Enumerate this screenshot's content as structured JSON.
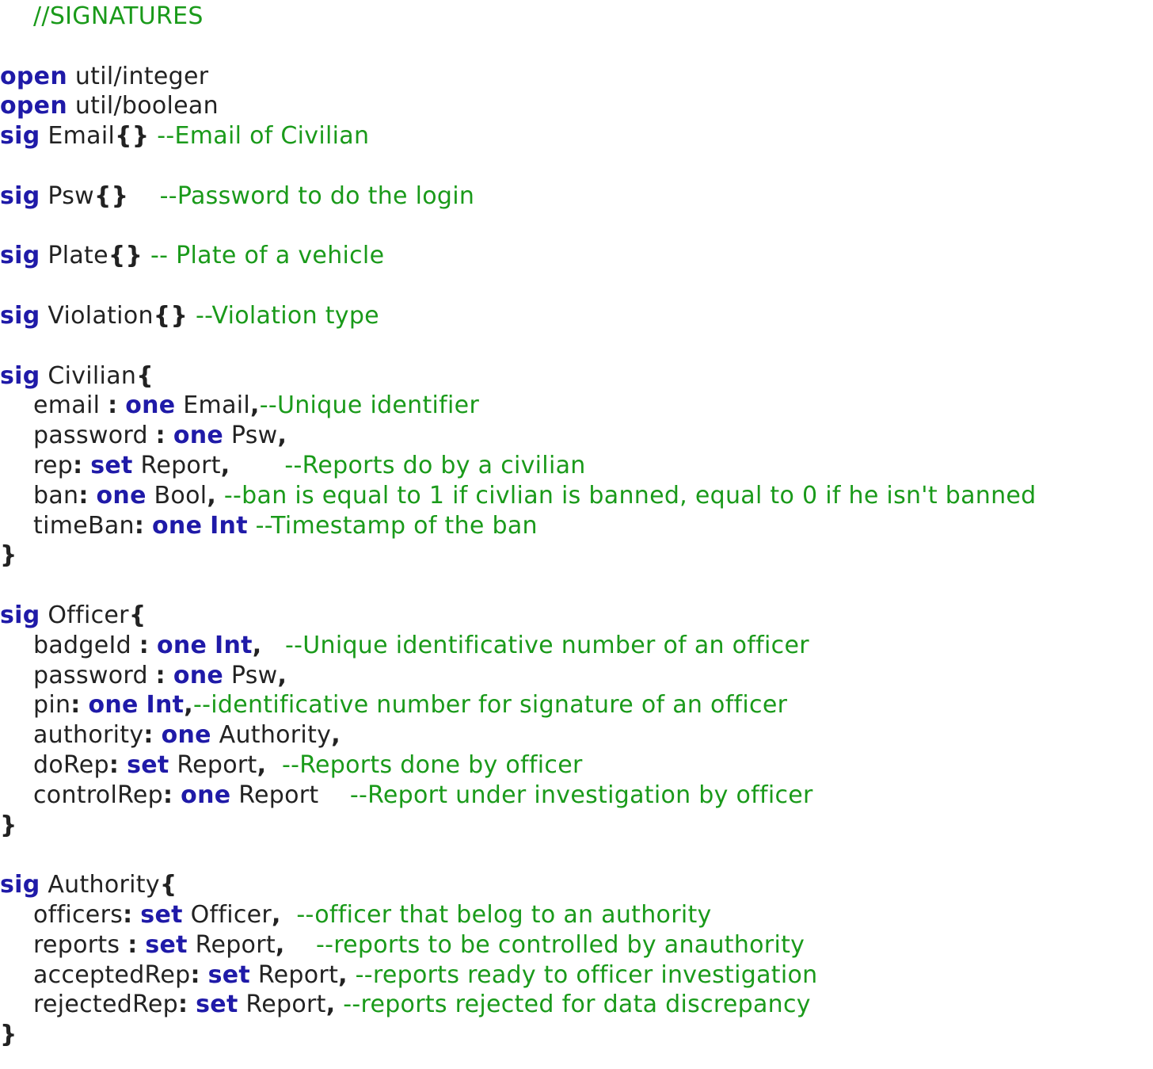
{
  "code": {
    "lines": [
      {
        "indent": true,
        "comment_only": true,
        "tokens": [
          {
            "t": "cm",
            "v": "//SIGNATURES"
          }
        ]
      },
      {
        "indent": false,
        "tokens": []
      },
      {
        "indent": false,
        "tokens": [
          {
            "t": "kw",
            "v": "open"
          },
          {
            "t": "tx",
            "v": " util/integer"
          }
        ]
      },
      {
        "indent": false,
        "tokens": [
          {
            "t": "kw",
            "v": "open"
          },
          {
            "t": "tx",
            "v": " util/boolean"
          }
        ]
      },
      {
        "indent": false,
        "tokens": [
          {
            "t": "kw",
            "v": "sig"
          },
          {
            "t": "tx",
            "v": " Email"
          },
          {
            "t": "br",
            "v": "{}"
          },
          {
            "t": "cm",
            "v": " --Email of Civilian"
          }
        ]
      },
      {
        "indent": false,
        "tokens": []
      },
      {
        "indent": false,
        "tokens": [
          {
            "t": "kw",
            "v": "sig"
          },
          {
            "t": "tx",
            "v": " Psw"
          },
          {
            "t": "br",
            "v": "{}"
          },
          {
            "t": "cm",
            "v": "    --Password to do the login"
          }
        ]
      },
      {
        "indent": false,
        "tokens": []
      },
      {
        "indent": false,
        "tokens": [
          {
            "t": "kw",
            "v": "sig"
          },
          {
            "t": "tx",
            "v": " Plate"
          },
          {
            "t": "br",
            "v": "{}"
          },
          {
            "t": "cm",
            "v": " -- Plate of a vehicle"
          }
        ]
      },
      {
        "indent": false,
        "tokens": []
      },
      {
        "indent": false,
        "tokens": [
          {
            "t": "kw",
            "v": "sig"
          },
          {
            "t": "tx",
            "v": " Violation"
          },
          {
            "t": "br",
            "v": "{}"
          },
          {
            "t": "cm",
            "v": " --Violation type"
          }
        ]
      },
      {
        "indent": false,
        "tokens": []
      },
      {
        "indent": false,
        "tokens": [
          {
            "t": "kw",
            "v": "sig"
          },
          {
            "t": "tx",
            "v": " Civilian"
          },
          {
            "t": "br",
            "v": "{"
          }
        ]
      },
      {
        "indent": true,
        "tokens": [
          {
            "t": "tx",
            "v": "email "
          },
          {
            "t": "br",
            "v": ":"
          },
          {
            "t": "tx",
            "v": " "
          },
          {
            "t": "kw",
            "v": "one"
          },
          {
            "t": "tx",
            "v": " Email"
          },
          {
            "t": "br",
            "v": ","
          },
          {
            "t": "cm",
            "v": "--Unique identifier"
          }
        ]
      },
      {
        "indent": true,
        "tokens": [
          {
            "t": "tx",
            "v": "password "
          },
          {
            "t": "br",
            "v": ":"
          },
          {
            "t": "tx",
            "v": " "
          },
          {
            "t": "kw",
            "v": "one"
          },
          {
            "t": "tx",
            "v": " Psw"
          },
          {
            "t": "br",
            "v": ","
          }
        ]
      },
      {
        "indent": true,
        "tokens": [
          {
            "t": "tx",
            "v": "rep"
          },
          {
            "t": "br",
            "v": ":"
          },
          {
            "t": "tx",
            "v": " "
          },
          {
            "t": "kw",
            "v": "set"
          },
          {
            "t": "tx",
            "v": " Report"
          },
          {
            "t": "br",
            "v": ","
          },
          {
            "t": "cm",
            "v": "       --Reports do by a civilian"
          }
        ]
      },
      {
        "indent": true,
        "tokens": [
          {
            "t": "tx",
            "v": "ban"
          },
          {
            "t": "br",
            "v": ":"
          },
          {
            "t": "tx",
            "v": " "
          },
          {
            "t": "kw",
            "v": "one"
          },
          {
            "t": "tx",
            "v": " Bool"
          },
          {
            "t": "br",
            "v": ","
          },
          {
            "t": "cm",
            "v": " --ban is equal to 1 if civlian is banned, equal to 0 if he isn't banned"
          }
        ]
      },
      {
        "indent": true,
        "tokens": [
          {
            "t": "tx",
            "v": "timeBan"
          },
          {
            "t": "br",
            "v": ":"
          },
          {
            "t": "tx",
            "v": " "
          },
          {
            "t": "kw",
            "v": "one"
          },
          {
            "t": "tx",
            "v": " "
          },
          {
            "t": "kw",
            "v": "Int"
          },
          {
            "t": "cm",
            "v": " --Timestamp of the ban"
          }
        ]
      },
      {
        "indent": false,
        "tokens": [
          {
            "t": "br",
            "v": "}"
          }
        ]
      },
      {
        "indent": false,
        "tokens": []
      },
      {
        "indent": false,
        "tokens": [
          {
            "t": "kw",
            "v": "sig"
          },
          {
            "t": "tx",
            "v": " Officer"
          },
          {
            "t": "br",
            "v": "{"
          }
        ]
      },
      {
        "indent": true,
        "tokens": [
          {
            "t": "tx",
            "v": "badgeId "
          },
          {
            "t": "br",
            "v": ":"
          },
          {
            "t": "tx",
            "v": " "
          },
          {
            "t": "kw",
            "v": "one"
          },
          {
            "t": "tx",
            "v": " "
          },
          {
            "t": "kw",
            "v": "Int"
          },
          {
            "t": "br",
            "v": ","
          },
          {
            "t": "cm",
            "v": "   --Unique identificative number of an officer"
          }
        ]
      },
      {
        "indent": true,
        "tokens": [
          {
            "t": "tx",
            "v": "password "
          },
          {
            "t": "br",
            "v": ":"
          },
          {
            "t": "tx",
            "v": " "
          },
          {
            "t": "kw",
            "v": "one"
          },
          {
            "t": "tx",
            "v": " Psw"
          },
          {
            "t": "br",
            "v": ","
          }
        ]
      },
      {
        "indent": true,
        "tokens": [
          {
            "t": "tx",
            "v": "pin"
          },
          {
            "t": "br",
            "v": ":"
          },
          {
            "t": "tx",
            "v": " "
          },
          {
            "t": "kw",
            "v": "one"
          },
          {
            "t": "tx",
            "v": " "
          },
          {
            "t": "kw",
            "v": "Int"
          },
          {
            "t": "br",
            "v": ","
          },
          {
            "t": "cm",
            "v": "--identificative number for signature of an officer"
          }
        ]
      },
      {
        "indent": true,
        "tokens": [
          {
            "t": "tx",
            "v": "authority"
          },
          {
            "t": "br",
            "v": ":"
          },
          {
            "t": "tx",
            "v": " "
          },
          {
            "t": "kw",
            "v": "one"
          },
          {
            "t": "tx",
            "v": " Authority"
          },
          {
            "t": "br",
            "v": ","
          }
        ]
      },
      {
        "indent": true,
        "tokens": [
          {
            "t": "tx",
            "v": "doRep"
          },
          {
            "t": "br",
            "v": ":"
          },
          {
            "t": "tx",
            "v": " "
          },
          {
            "t": "kw",
            "v": "set"
          },
          {
            "t": "tx",
            "v": " Report"
          },
          {
            "t": "br",
            "v": ","
          },
          {
            "t": "cm",
            "v": "  --Reports done by officer"
          }
        ]
      },
      {
        "indent": true,
        "tokens": [
          {
            "t": "tx",
            "v": "controlRep"
          },
          {
            "t": "br",
            "v": ":"
          },
          {
            "t": "tx",
            "v": " "
          },
          {
            "t": "kw",
            "v": "one"
          },
          {
            "t": "tx",
            "v": " Report"
          },
          {
            "t": "cm",
            "v": "    --Report under investigation by officer"
          }
        ]
      },
      {
        "indent": false,
        "tokens": [
          {
            "t": "br",
            "v": "}"
          }
        ]
      },
      {
        "indent": false,
        "tokens": []
      },
      {
        "indent": false,
        "tokens": [
          {
            "t": "kw",
            "v": "sig"
          },
          {
            "t": "tx",
            "v": " Authority"
          },
          {
            "t": "br",
            "v": "{"
          }
        ]
      },
      {
        "indent": true,
        "tokens": [
          {
            "t": "tx",
            "v": "officers"
          },
          {
            "t": "br",
            "v": ":"
          },
          {
            "t": "tx",
            "v": " "
          },
          {
            "t": "kw",
            "v": "set"
          },
          {
            "t": "tx",
            "v": " Officer"
          },
          {
            "t": "br",
            "v": ","
          },
          {
            "t": "cm",
            "v": "  --officer that belog to an authority"
          }
        ]
      },
      {
        "indent": true,
        "tokens": [
          {
            "t": "tx",
            "v": "reports "
          },
          {
            "t": "br",
            "v": ":"
          },
          {
            "t": "tx",
            "v": " "
          },
          {
            "t": "kw",
            "v": "set"
          },
          {
            "t": "tx",
            "v": " Report"
          },
          {
            "t": "br",
            "v": ","
          },
          {
            "t": "cm",
            "v": "    --reports to be controlled by anauthority"
          }
        ]
      },
      {
        "indent": true,
        "tokens": [
          {
            "t": "tx",
            "v": "acceptedRep"
          },
          {
            "t": "br",
            "v": ":"
          },
          {
            "t": "tx",
            "v": " "
          },
          {
            "t": "kw",
            "v": "set"
          },
          {
            "t": "tx",
            "v": " Report"
          },
          {
            "t": "br",
            "v": ","
          },
          {
            "t": "cm",
            "v": " --reports ready to officer investigation"
          }
        ]
      },
      {
        "indent": true,
        "tokens": [
          {
            "t": "tx",
            "v": "rejectedRep"
          },
          {
            "t": "br",
            "v": ":"
          },
          {
            "t": "tx",
            "v": " "
          },
          {
            "t": "kw",
            "v": "set"
          },
          {
            "t": "tx",
            "v": " Report"
          },
          {
            "t": "br",
            "v": ","
          },
          {
            "t": "cm",
            "v": " --reports rejected for data discrepancy"
          }
        ]
      },
      {
        "indent": false,
        "tokens": [
          {
            "t": "br",
            "v": "}"
          }
        ]
      }
    ]
  },
  "colors": {
    "keyword": "#1f1aa8",
    "text": "#222222",
    "comment": "#1a9a1a",
    "background": "#ffffff"
  }
}
